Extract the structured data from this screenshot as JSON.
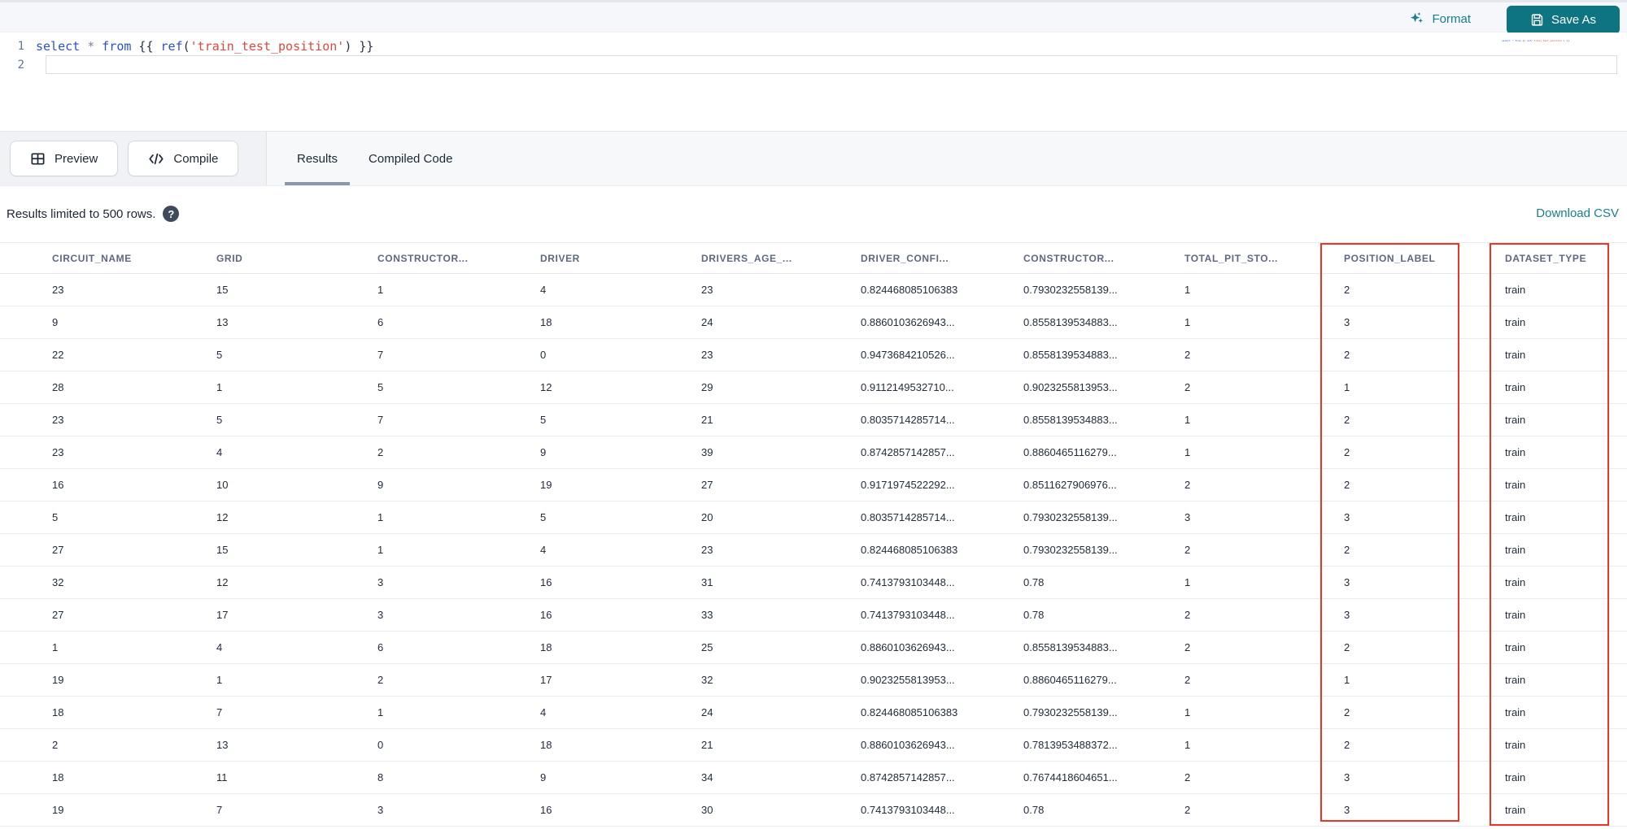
{
  "toolbar": {
    "format_label": "Format",
    "save_as_label": "Save As"
  },
  "editor": {
    "line_numbers": [
      "1",
      "2"
    ],
    "code_tokens": [
      {
        "text": "select",
        "type": "keyword"
      },
      {
        "text": " ",
        "type": "plain"
      },
      {
        "text": "*",
        "type": "operator"
      },
      {
        "text": " ",
        "type": "plain"
      },
      {
        "text": "from",
        "type": "keyword"
      },
      {
        "text": " {{ ",
        "type": "plain"
      },
      {
        "text": "ref",
        "type": "function"
      },
      {
        "text": "(",
        "type": "plain"
      },
      {
        "text": "'train_test_position'",
        "type": "string"
      },
      {
        "text": ")",
        "type": "plain"
      },
      {
        "text": " }}",
        "type": "plain"
      }
    ]
  },
  "panel": {
    "preview_label": "Preview",
    "compile_label": "Compile",
    "tabs": [
      {
        "label": "Results",
        "active": true
      },
      {
        "label": "Compiled Code",
        "active": false
      }
    ]
  },
  "results": {
    "limit_note": "Results limited to 500 rows.",
    "help_icon": "question-mark-icon",
    "download_label": "Download CSV"
  },
  "table": {
    "columns": [
      "CIRCUIT_NAME",
      "GRID",
      "CONSTRUCTOR...",
      "DRIVER",
      "DRIVERS_AGE_...",
      "DRIVER_CONFI...",
      "CONSTRUCTOR...",
      "TOTAL_PIT_STO...",
      "POSITION_LABEL",
      "DATASET_TYPE"
    ],
    "rows": [
      [
        "23",
        "15",
        "1",
        "4",
        "23",
        "0.824468085106383",
        "0.7930232558139...",
        "1",
        "2",
        "train"
      ],
      [
        "9",
        "13",
        "6",
        "18",
        "24",
        "0.8860103626943...",
        "0.8558139534883...",
        "1",
        "3",
        "train"
      ],
      [
        "22",
        "5",
        "7",
        "0",
        "23",
        "0.9473684210526...",
        "0.8558139534883...",
        "2",
        "2",
        "train"
      ],
      [
        "28",
        "1",
        "5",
        "12",
        "29",
        "0.9112149532710...",
        "0.9023255813953...",
        "2",
        "1",
        "train"
      ],
      [
        "23",
        "5",
        "7",
        "5",
        "21",
        "0.8035714285714...",
        "0.8558139534883...",
        "1",
        "2",
        "train"
      ],
      [
        "23",
        "4",
        "2",
        "9",
        "39",
        "0.8742857142857...",
        "0.8860465116279...",
        "1",
        "2",
        "train"
      ],
      [
        "16",
        "10",
        "9",
        "19",
        "27",
        "0.9171974522292...",
        "0.8511627906976...",
        "2",
        "2",
        "train"
      ],
      [
        "5",
        "12",
        "1",
        "5",
        "20",
        "0.8035714285714...",
        "0.7930232558139...",
        "3",
        "3",
        "train"
      ],
      [
        "27",
        "15",
        "1",
        "4",
        "23",
        "0.824468085106383",
        "0.7930232558139...",
        "2",
        "2",
        "train"
      ],
      [
        "32",
        "12",
        "3",
        "16",
        "31",
        "0.7413793103448...",
        "0.78",
        "1",
        "3",
        "train"
      ],
      [
        "27",
        "17",
        "3",
        "16",
        "33",
        "0.7413793103448...",
        "0.78",
        "2",
        "3",
        "train"
      ],
      [
        "1",
        "4",
        "6",
        "18",
        "25",
        "0.8860103626943...",
        "0.8558139534883...",
        "2",
        "2",
        "train"
      ],
      [
        "19",
        "1",
        "2",
        "17",
        "32",
        "0.9023255813953...",
        "0.8860465116279...",
        "2",
        "1",
        "train"
      ],
      [
        "18",
        "7",
        "1",
        "4",
        "24",
        "0.824468085106383",
        "0.7930232558139...",
        "1",
        "2",
        "train"
      ],
      [
        "2",
        "13",
        "0",
        "18",
        "21",
        "0.8860103626943...",
        "0.7813953488372...",
        "1",
        "2",
        "train"
      ],
      [
        "18",
        "11",
        "8",
        "9",
        "34",
        "0.8742857142857...",
        "0.7674418604651...",
        "2",
        "3",
        "train"
      ],
      [
        "19",
        "7",
        "3",
        "16",
        "30",
        "0.7413793103448...",
        "0.78",
        "2",
        "3",
        "train"
      ]
    ],
    "highlighted_columns": [
      "POSITION_LABEL",
      "DATASET_TYPE"
    ]
  },
  "colors": {
    "accent_teal": "#0f7482",
    "link_teal": "#178090",
    "highlight_red": "#ee3524",
    "keyword_blue": "#2950d6",
    "string_red": "#e0473c",
    "band_gray": "#f1f2f5"
  }
}
